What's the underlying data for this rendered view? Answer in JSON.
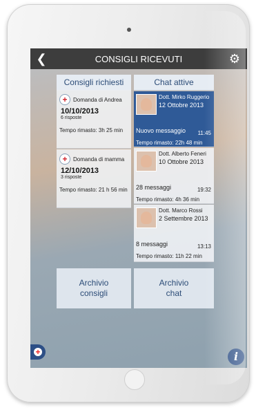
{
  "header": {
    "title": "CONSIGLI RICEVUTI",
    "back_icon": "chevron-left-icon",
    "settings_icon": "gear-icon"
  },
  "left_panel": {
    "tab_label": "Consigli richiesti",
    "cards": [
      {
        "label": "Domanda di Andrea",
        "date": "10/10/2013",
        "answers": "6 risposte",
        "remaining": "Tempo rimasto: 3h 25 min"
      },
      {
        "label": "Domanda di mamma",
        "date": "12/10/2013",
        "answers": "3 risposte",
        "remaining": "Tempo rimasto: 21 h 56 min"
      }
    ]
  },
  "right_panel": {
    "tab_label": "Chat attive",
    "chats": [
      {
        "doctor": "Dott. Mirko Ruggerio",
        "date": "12 Ottobre 2013",
        "messages": "Nuovo messaggio",
        "time": "11:45",
        "remaining": "Tempo rimasto: 22h 48 min",
        "active": true
      },
      {
        "doctor": "Dott. Alberto Feneri",
        "date": "10 Ottobre 2013",
        "messages": "28 messaggi",
        "time": "19:32",
        "remaining": "Tempo rimasto: 4h 36 min",
        "active": false
      },
      {
        "doctor": "Dott. Marco Rossi",
        "date": "2 Settembre 2013",
        "messages": "8 messaggi",
        "time": "13:13",
        "remaining": "Tempo rimasto: 11h 22 min",
        "active": false
      }
    ]
  },
  "archive": {
    "advice_line1": "Archivio",
    "advice_line2": "consigli",
    "chat_line1": "Archivio",
    "chat_line2": "chat"
  },
  "footer": {
    "info_label": "i",
    "cross_symbol": "+"
  },
  "colors": {
    "accent": "#2f5a97",
    "tab_text": "#2c4c77",
    "alert": "#d0202a"
  }
}
